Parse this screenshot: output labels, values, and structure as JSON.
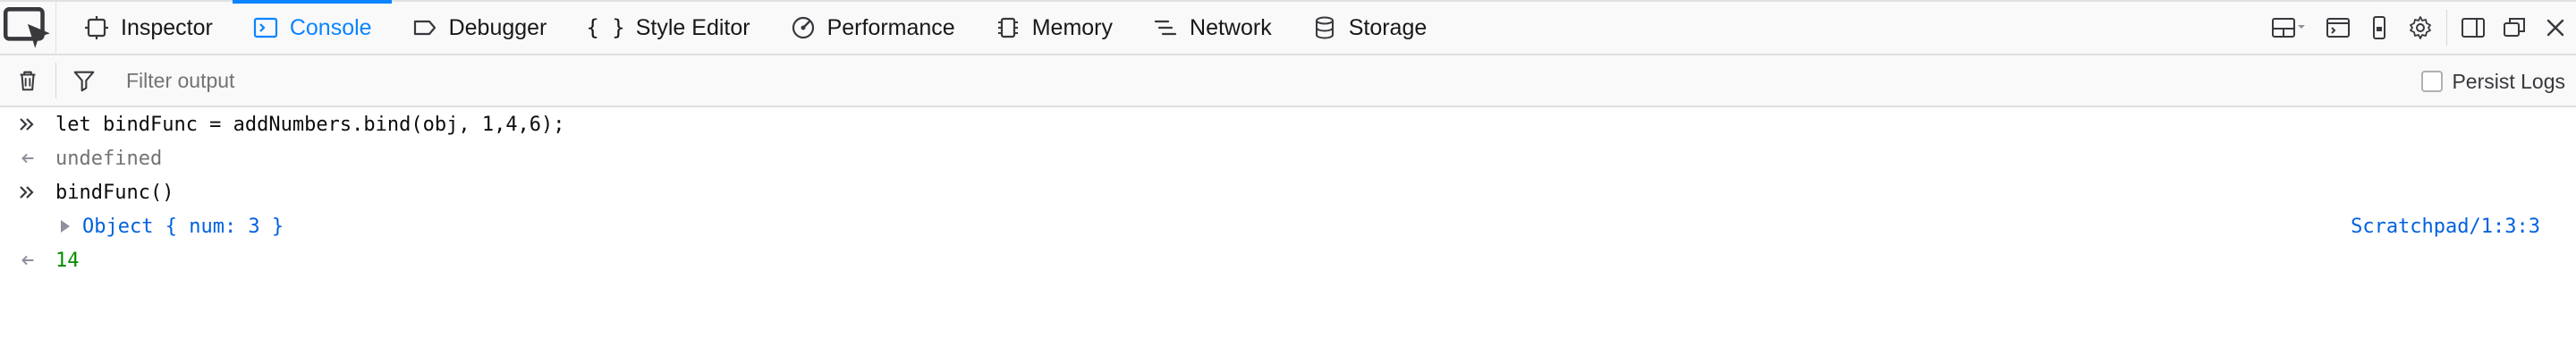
{
  "toolbar": {
    "tabs": [
      {
        "label": "Inspector",
        "icon": "inspector-icon"
      },
      {
        "label": "Console",
        "icon": "console-icon",
        "active": true
      },
      {
        "label": "Debugger",
        "icon": "debugger-icon"
      },
      {
        "label": "Style Editor",
        "icon": "braces-icon"
      },
      {
        "label": "Performance",
        "icon": "performance-icon"
      },
      {
        "label": "Memory",
        "icon": "memory-icon"
      },
      {
        "label": "Network",
        "icon": "network-icon"
      },
      {
        "label": "Storage",
        "icon": "storage-icon"
      }
    ],
    "right_tools": [
      "dock-layout-icon",
      "scratchpad-icon",
      "responsive-design-icon",
      "settings-gear-icon",
      "sidebar-toggle-icon",
      "undock-icon",
      "close-icon"
    ]
  },
  "filter": {
    "placeholder": "Filter output",
    "persist_label": "Persist Logs"
  },
  "console": {
    "lines": [
      {
        "kind": "input",
        "text": "let bindFunc = addNumbers.bind(obj, 1,4,6);"
      },
      {
        "kind": "return",
        "text": "undefined"
      },
      {
        "kind": "input",
        "text": "bindFunc()"
      },
      {
        "kind": "object",
        "text": "Object { num: 3 }",
        "source": "Scratchpad/1:3:3"
      },
      {
        "kind": "return-number",
        "text": "14"
      }
    ]
  },
  "colors": {
    "accent": "#0a84ff",
    "number": "#058b00",
    "link": "#0060df"
  }
}
